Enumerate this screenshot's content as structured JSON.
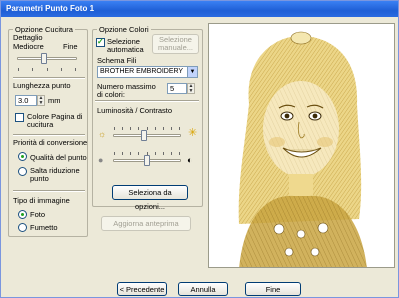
{
  "window": {
    "title": "Parametri Punto Foto 1"
  },
  "cucitura": {
    "legend": "Opzione Cucitura",
    "dettaglio_label": "Dettaglio",
    "mediocre_label": "Mediocre",
    "fine_label": "Fine",
    "dettaglio_level": 0.45,
    "lunghezza_label": "Lunghezza punto",
    "lunghezza_value": "3.0",
    "lunghezza_unit": "mm",
    "colore_pagina_label": "Colore Pagina di cucitura",
    "colore_pagina_checked": false
  },
  "priorita": {
    "legend": "Priorità di conversione",
    "options": [
      {
        "label": "Qualità del punto",
        "checked": true
      },
      {
        "label": "Salta riduzione punto",
        "checked": false
      }
    ]
  },
  "tipo_immagine": {
    "legend": "Tipo di immagine",
    "options": [
      {
        "label": "Foto",
        "checked": true
      },
      {
        "label": "Fumetto",
        "checked": false
      }
    ]
  },
  "colori": {
    "legend": "Opzione Colori",
    "selezione_auto_label": "Selezione automatica",
    "selezione_auto_checked": true,
    "selezione_manuale_label": "Selezione manuale...",
    "schema_label": "Schema Fili",
    "schema_value": "BROTHER EMBROIDERY",
    "numero_label": "Numero massimo di colori:",
    "numero_value": "5"
  },
  "luminosita": {
    "legend": "Luminosità / Contrasto",
    "brightness_level": 0.45,
    "contrast_level": 0.5,
    "icons": {
      "brightness_low": "sun-small-icon",
      "brightness_high": "sun-large-icon",
      "contrast_low": "circle-gray-icon",
      "contrast_high": "half-circle-icon"
    },
    "seleziona_button": "Seleziona da opzioni..."
  },
  "aggiorna_button": "Aggiorna anteprima",
  "footer": {
    "precedente": "< Precedente",
    "annulla": "Annulla",
    "fine": "Fine"
  },
  "colors": {
    "check_green": "#21a121",
    "title_blue": "#1f5fd6",
    "sepia": "#c9a441"
  }
}
